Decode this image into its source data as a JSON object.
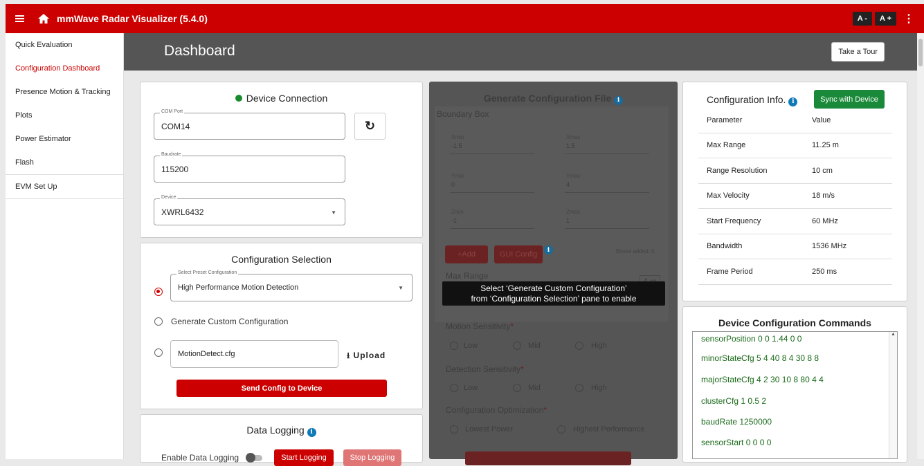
{
  "app": {
    "title": "mmWave Radar Visualizer (5.4.0)",
    "font_dec": "A -",
    "font_inc": "A +"
  },
  "sidebar": {
    "items": [
      {
        "label": "Quick Evaluation"
      },
      {
        "label": "Configuration Dashboard"
      },
      {
        "label": "Presence Motion & Tracking"
      },
      {
        "label": "Plots"
      },
      {
        "label": "Power Estimator"
      },
      {
        "label": "Flash"
      },
      {
        "label": "EVM Set Up"
      }
    ],
    "active_index": 1
  },
  "header": {
    "title": "Dashboard",
    "tour_label": "Take a Tour"
  },
  "device_connection": {
    "title": "Device Connection",
    "com_port": {
      "label": "COM Port",
      "value": "COM14"
    },
    "baudrate": {
      "label": "Baudrate",
      "value": "115200"
    },
    "device": {
      "label": "Device",
      "value": "XWRL6432"
    }
  },
  "config_selection": {
    "title": "Configuration Selection",
    "preset": {
      "label": "Select Preset Configuration",
      "value": "High Performance Motion Detection"
    },
    "custom_label": "Generate Custom Configuration",
    "file_value": "MotionDetect.cfg",
    "upload_label": "Upload",
    "send_label": "Send Config to Device"
  },
  "data_logging": {
    "title": "Data Logging",
    "enable_label": "Enable Data Logging",
    "start_label": "Start Logging",
    "stop_label": "Stop Logging"
  },
  "generate": {
    "title": "Generate Configuration File",
    "boundary_title": "Boundary Box",
    "xmin": {
      "label": "Xmin",
      "value": "-1.5"
    },
    "xmax": {
      "label": "Xmax",
      "value": "1.5"
    },
    "ymin": {
      "label": "Ymin",
      "value": "0"
    },
    "ymax": {
      "label": "Ymax",
      "value": "4"
    },
    "zmin": {
      "label": "Zmin",
      "value": "-1"
    },
    "zmax": {
      "label": "Zmax",
      "value": "1"
    },
    "add_label": "+Add",
    "gui_config_label": "GUI Config",
    "boxes_added": "Boxes added: 0",
    "max_range_label": "Max Range",
    "max_range_value": "4 m",
    "motion_label": "Motion Sensitivity",
    "detection_label": "Detection Sensitivity",
    "levels": [
      "Low",
      "Mid",
      "High"
    ],
    "optimization_label": "Configuration Optimization",
    "opt_options": [
      "Lowest Power",
      "Highest Performance"
    ],
    "tooltip_line1": "Select ‘Generate Custom Configuration’",
    "tooltip_line2": "from ‘Configuration Selection’ pane to enable"
  },
  "config_info": {
    "title": "Configuration Info.",
    "sync_label": "Sync with Device",
    "header": {
      "param": "Parameter",
      "value": "Value"
    },
    "rows": [
      {
        "param": "Max Range",
        "value": "11.25 m"
      },
      {
        "param": "Range Resolution",
        "value": "10 cm"
      },
      {
        "param": "Max Velocity",
        "value": "18 m/s"
      },
      {
        "param": "Start Frequency",
        "value": "60 MHz"
      },
      {
        "param": "Bandwidth",
        "value": "1536 MHz"
      },
      {
        "param": "Frame Period",
        "value": "250 ms"
      }
    ]
  },
  "device_commands": {
    "title": "Device Configuration Commands",
    "lines": [
      "sensorPosition 0 0 1.44 0 0",
      "minorStateCfg 5 4 40 8 4 30 8 8",
      "majorStateCfg 4 2 30 10 8 80 4 4",
      "clusterCfg 1 0.5 2",
      "baudRate 1250000",
      "sensorStart 0 0 0 0",
      "%"
    ]
  }
}
